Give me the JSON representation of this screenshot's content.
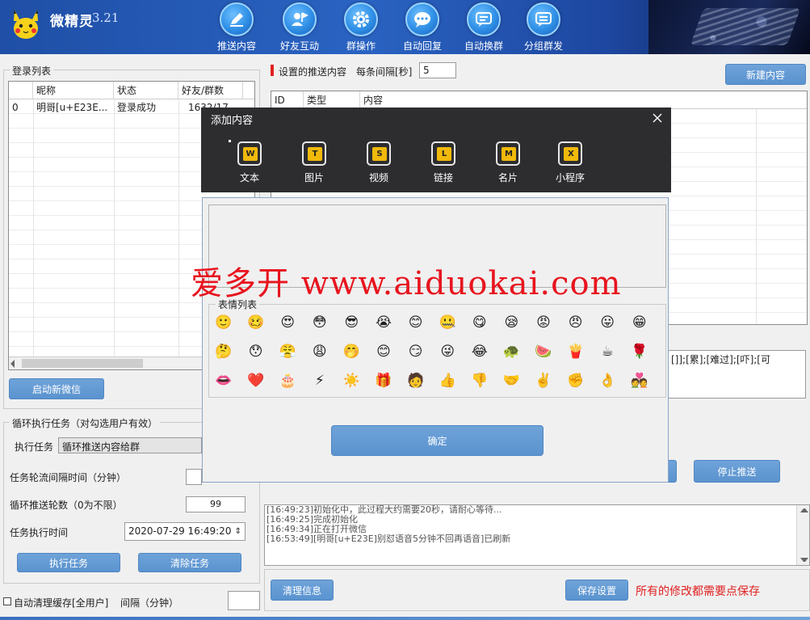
{
  "app": {
    "name": "微精灵",
    "version": "3.21"
  },
  "nav": [
    {
      "label": "推送内容",
      "icon": "pen-icon"
    },
    {
      "label": "好友互动",
      "icon": "user-flag-icon"
    },
    {
      "label": "群操作",
      "icon": "gear-icon"
    },
    {
      "label": "自动回复",
      "icon": "chat-bubble-icon"
    },
    {
      "label": "自动换群",
      "icon": "chat-switch-icon"
    },
    {
      "label": "分组群发",
      "icon": "chat-group-icon"
    }
  ],
  "login": {
    "title": "登录列表",
    "columns": [
      "昵称",
      "状态",
      "好友/群数"
    ],
    "rows": [
      {
        "id": "0",
        "nick": "明哥[u+E23E...",
        "status": "登录成功",
        "count": "1632/17"
      }
    ],
    "start_button": "启动新微信"
  },
  "loop": {
    "title": "循环执行任务（对勾选用户有效）",
    "task_label": "执行任务",
    "task_value": "循环推送内容给群",
    "interval_label": "任务轮流间隔时间（分钟）",
    "interval_value": "",
    "rounds_label": "循环推送轮数（0为不限）",
    "rounds_value": "99",
    "time_label": "任务执行时间",
    "time_value": "2020-07-29 16:49:20",
    "run_button": "执行任务",
    "clear_button": "清除任务",
    "auto_clean_label": "自动清理缓存[全用户]",
    "auto_clean_interval_label": "间隔（分钟）",
    "auto_clean_interval_value": ""
  },
  "push": {
    "title": "设置的推送内容",
    "interval_label": "每条间隔[秒]",
    "interval_value": "5",
    "new_button": "新建内容",
    "columns": [
      "ID",
      "类型",
      "内容"
    ],
    "emoji_codes": "[]];[累];[难过];[吓];[可",
    "stop_button": "停止推送"
  },
  "log": [
    "[16:49:23]初始化中，此过程大约需要20秒，请耐心等待...",
    "[16:49:25]完成初始化",
    "[16:49:34]正在打开微信",
    "[16:53:49][明哥[u+E23E]别怼语音5分钟不回再语音]已刷新"
  ],
  "footer": {
    "clear_button": "清理信息",
    "save_button": "保存设置",
    "save_note": "所有的修改都需要点保存"
  },
  "modal": {
    "title": "添加内容",
    "tools": [
      {
        "label": "文本",
        "badge": "W"
      },
      {
        "label": "图片",
        "badge": "T"
      },
      {
        "label": "视频",
        "badge": "S"
      },
      {
        "label": "链接",
        "badge": "L"
      },
      {
        "label": "名片",
        "badge": "M"
      },
      {
        "label": "小程序",
        "badge": "X"
      }
    ],
    "text_value": "",
    "emoji_title": "表情列表",
    "emojis": [
      "🙂",
      "🥴",
      "😍",
      "😳",
      "😎",
      "😭",
      "😊",
      "🤐",
      "😋",
      "😪",
      "😡",
      "😠",
      "😛",
      "😁",
      "🤔",
      "😯",
      "😤",
      "😩",
      "🤭",
      "😊",
      "😏",
      "😜",
      "😂",
      "🐢",
      "🍉",
      "🍟",
      "☕",
      "🌹",
      "👄",
      "❤️",
      "🎂",
      "⚡",
      "☀️",
      "🎁",
      "🧑",
      "👍",
      "👎",
      "🤝",
      "✌️",
      "✊",
      "👌",
      "💑"
    ],
    "confirm_button": "确定"
  },
  "watermark": "爱多开 www.aiduokai.com",
  "colors": {
    "accent": "#5a93cf",
    "title_bar": "#2d2d30",
    "save_note": "#e02020",
    "watermark": "#e8141e"
  }
}
